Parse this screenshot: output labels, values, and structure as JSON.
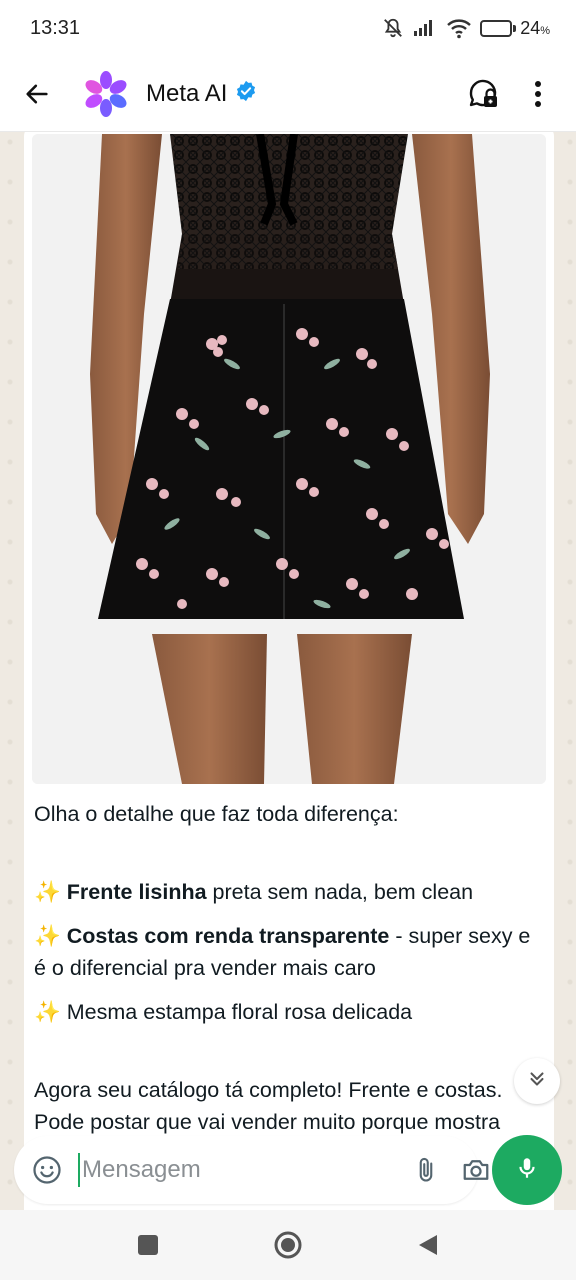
{
  "status": {
    "time": "13:31",
    "battery_percent": "24",
    "battery_level": 0.24,
    "icons": [
      "mute-bell-icon",
      "signal-icon",
      "wifi-icon",
      "battery-icon"
    ]
  },
  "header": {
    "contact_name": "Meta AI",
    "verified": true,
    "icons": [
      "back-arrow-icon",
      "meta-ai-logo",
      "verified-icon",
      "lock-chat-icon",
      "more-vertical-icon"
    ]
  },
  "message": {
    "intro": "Olha o detalhe que faz toda diferença:",
    "items": [
      {
        "emoji": "✨",
        "bold": "Frente lisinha",
        "rest": " preta sem nada, bem clean"
      },
      {
        "emoji": "✨",
        "bold": "Costas com renda transparente",
        "rest": " - super sexy e é o diferencial pra vender mais caro"
      },
      {
        "emoji": "✨",
        "bold": "",
        "rest": " Mesma estampa floral rosa delicada"
      }
    ],
    "closing_line1": "Agora seu catálogo tá completo! Frente e costas.",
    "closing_line2": "Pode postar que vai vender muito porque mostra"
  },
  "composer": {
    "placeholder": "Mensagem",
    "icons": [
      "emoji-icon",
      "attach-icon",
      "camera-icon",
      "mic-icon"
    ]
  },
  "navbar": {
    "icons": [
      "recents-icon",
      "home-icon",
      "back-icon"
    ]
  },
  "colors": {
    "accent_green": "#1daa61",
    "chat_bg": "#efeae2",
    "verified_blue": "#1d9bf0"
  }
}
